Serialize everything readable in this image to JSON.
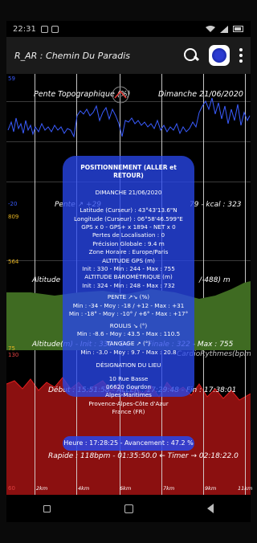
{
  "status": {
    "time": "22:31",
    "battery_icon": "battery-icon",
    "wifi_icon": "wifi-icon"
  },
  "appbar": {
    "title": "R_AR : Chemin Du Paradis"
  },
  "panel1": {
    "axis_top": "59",
    "axis_bottom": "-20",
    "header_left": "Pente Topographique (%)",
    "header_right": "Dimanche  21/06/2020",
    "bottom_label_left": "Pente ↗ +29",
    "bottom_label_right": "79 - kcal : 323"
  },
  "panel2": {
    "axis_top": "809",
    "axis_mid": "564",
    "axis_bottom": "75",
    "left_label": "Altitude",
    "right_label": "/-488) m",
    "bottom_label_left": "Altitude(m) - Init : 330 - Dé",
    "bottom_label_right": "Finale : 322 - Max : 755"
  },
  "panel3": {
    "axis_top": "130",
    "axis_bottom": "60",
    "top_right_label": "CardioRythmes(bpm)",
    "debut_line": "Début : 15:51:58 - ALLER : 17:29:48 - Fin : 17:38:01",
    "rapide_line": "Rapide : 118bpm - 01:35:50.0 ← Timer → 02:18:22.0"
  },
  "card": {
    "title": "POSITIONNEMENT  (ALLER et RETOUR)",
    "date": "DIMANCHE  21/06/2020",
    "lines": [
      "Latitude (Curseur) : 43°43'13.6\"N",
      "Longitude (Curseur) : 06°58'46.599\"E",
      "GPS x 0 - GPS+ x 1894 - NET x 0",
      "Pertes de Localisation : 0",
      "Précision Globale : 9.4 m",
      "Zone Horaire : Europe/Paris",
      "ALTITUDE GPS (m)",
      "Init : 330 - Min : 244 - Max : 755",
      "ALTITUDE BAROMÉTRIQUE (m)",
      "Init : 324 - Min : 248 - Max : 732",
      "PENTE ↗↘ (%)",
      "Min : -34 - Moy : -18 / +12 - Max : +31",
      "Min : -18° - Moy : -10° / +6° - Max : +17°",
      "ROULIS ↘ (°)",
      "Min : -8.6 - Moy : 43.5 - Max : 110.5",
      "TANGAGE ↗ (°)",
      "Min : -3.0 - Moy : 9.7 - Max : 20.8",
      "DÉSIGNATION DU LIEU",
      "10 Rue Basse",
      "06620  Gourdon",
      "Alpes-Maritimes",
      "Provence-Alpes-Côte d'Azur",
      "France (FR)"
    ]
  },
  "pill": {
    "text": "Heure : 17:28:25 - Avancement : 47.2 %"
  },
  "xticks": [
    "2km",
    "4km",
    "6km",
    "7km",
    "9km",
    "11km"
  ],
  "chart_data": [
    {
      "type": "area",
      "title": "Pente Topographique (%)",
      "ylim": [
        -20,
        59
      ],
      "note": "blue slope trace with high values between ~4km and ~8km"
    },
    {
      "type": "area",
      "title": "Altitude(m)",
      "ylim": [
        75,
        809
      ],
      "series": [
        {
          "name": "Altitude",
          "values": [
            330,
            360,
            420,
            560,
            700,
            755,
            700,
            560,
            430,
            360,
            330,
            322
          ]
        }
      ]
    },
    {
      "type": "line",
      "title": "CardioRythmes(bpm)",
      "ylim": [
        60,
        130
      ]
    }
  ]
}
